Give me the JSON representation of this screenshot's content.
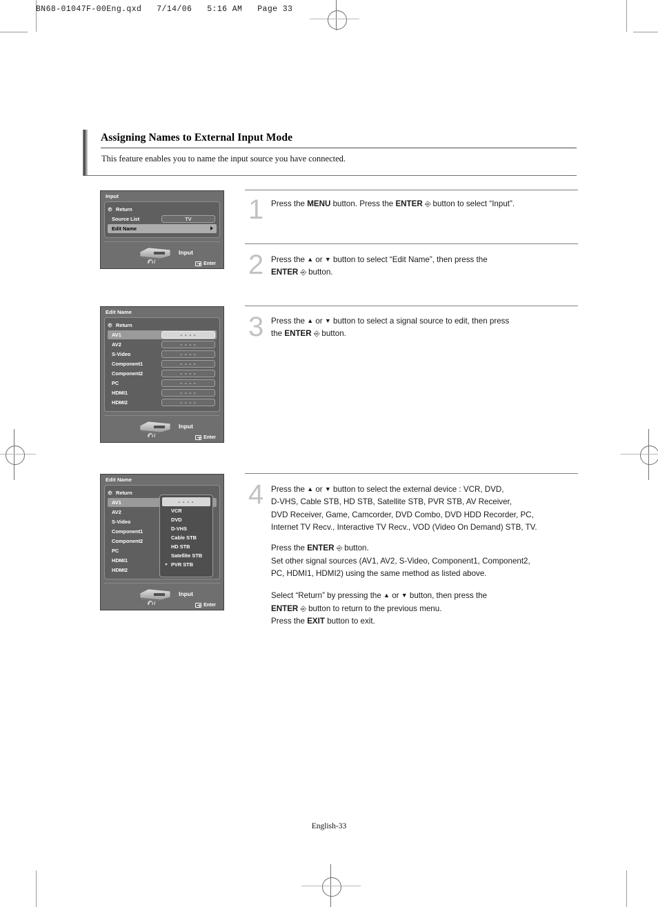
{
  "page_header": "BN68-01047F-00Eng.qxd   7/14/06   5:16 AM   Page 33",
  "section": {
    "title": "Assigning Names to External Input Mode",
    "intro": "This feature enables you to name the input source you have connected."
  },
  "footer": "English-33",
  "osd_panels": [
    {
      "id": "input-menu",
      "title": "Input",
      "rows": [
        {
          "label": "Return",
          "type": "return"
        },
        {
          "label": "Source List",
          "value": "TV",
          "type": "value"
        },
        {
          "label": "Edit Name",
          "type": "submenu",
          "selected": true
        }
      ],
      "footer_label": "Input",
      "enter_label": "Enter"
    },
    {
      "id": "edit-name-list",
      "title": "Edit Name",
      "rows": [
        {
          "label": "Return",
          "type": "return"
        },
        {
          "label": "AV1",
          "value": "- - - -",
          "type": "value",
          "selected": true
        },
        {
          "label": "AV2",
          "value": "- - - -",
          "type": "value"
        },
        {
          "label": "S-Video",
          "value": "- - - -",
          "type": "value"
        },
        {
          "label": "Component1",
          "value": "- - - -",
          "type": "value"
        },
        {
          "label": "Component2",
          "value": "- - - -",
          "type": "value"
        },
        {
          "label": "PC",
          "value": "- - - -",
          "type": "value"
        },
        {
          "label": "HDMI1",
          "value": "- - - -",
          "type": "value"
        },
        {
          "label": "HDMI2",
          "value": "- - - -",
          "type": "value"
        }
      ],
      "footer_label": "Input",
      "enter_label": "Enter"
    },
    {
      "id": "edit-name-dropdown",
      "title": "Edit Name",
      "rows": [
        {
          "label": "Return",
          "type": "return"
        },
        {
          "label": "AV1",
          "type": "plain",
          "selected": true
        },
        {
          "label": "AV2",
          "type": "plain"
        },
        {
          "label": "S-Video",
          "type": "plain"
        },
        {
          "label": "Component1",
          "type": "plain"
        },
        {
          "label": "Component2",
          "type": "plain"
        },
        {
          "label": "PC",
          "type": "plain"
        },
        {
          "label": "HDMI1",
          "type": "plain"
        },
        {
          "label": "HDMI2",
          "type": "plain"
        }
      ],
      "dropdown_options": [
        "- - - -",
        "VCR",
        "DVD",
        "D-VHS",
        "Cable STB",
        "HD STB",
        "Satellite STB",
        "PVR STB"
      ],
      "footer_label": "Input",
      "enter_label": "Enter"
    }
  ],
  "steps": [
    {
      "number": "1",
      "lines": [
        "Press the MENU button. Press the ENTER ⏎ button to select “Input”."
      ]
    },
    {
      "number": "2",
      "lines": [
        "Press the ▲ or ▼ button to select “Edit Name”, then press the",
        "ENTER ⏎ button."
      ]
    },
    {
      "number": "3",
      "lines": [
        "Press the ▲ or ▼ button to select a signal source to edit, then press",
        "the ENTER ⏎ button."
      ]
    },
    {
      "number": "4",
      "lines": [
        "Press the ▲ or ▼ button to select the external device : VCR, DVD,",
        "D-VHS, Cable STB, HD STB, Satellite STB, PVR STB, AV Receiver,",
        "DVD Receiver, Game, Camcorder, DVD Combo, DVD HDD Recorder, PC,",
        "Internet TV Recv., Interactive TV Recv., VOD (Video On Demand) STB, TV.",
        "Press the ENTER ⏎ button.",
        "Set other signal sources (AV1, AV2, S-Video, Component1, Component2,",
        "PC, HDMI1, HDMI2) using the same method as listed above.",
        "Select “Return” by pressing the ▲ or ▼ button, then press the",
        "ENTER ⏎ button to return to the previous menu.",
        "Press the EXIT button to exit."
      ]
    }
  ],
  "colors": {
    "osd_panel": "#6f6f6f",
    "osd_inner": "#5f5f5f",
    "step_number": "#c2c2c2",
    "rule": "#7d7d7d"
  }
}
